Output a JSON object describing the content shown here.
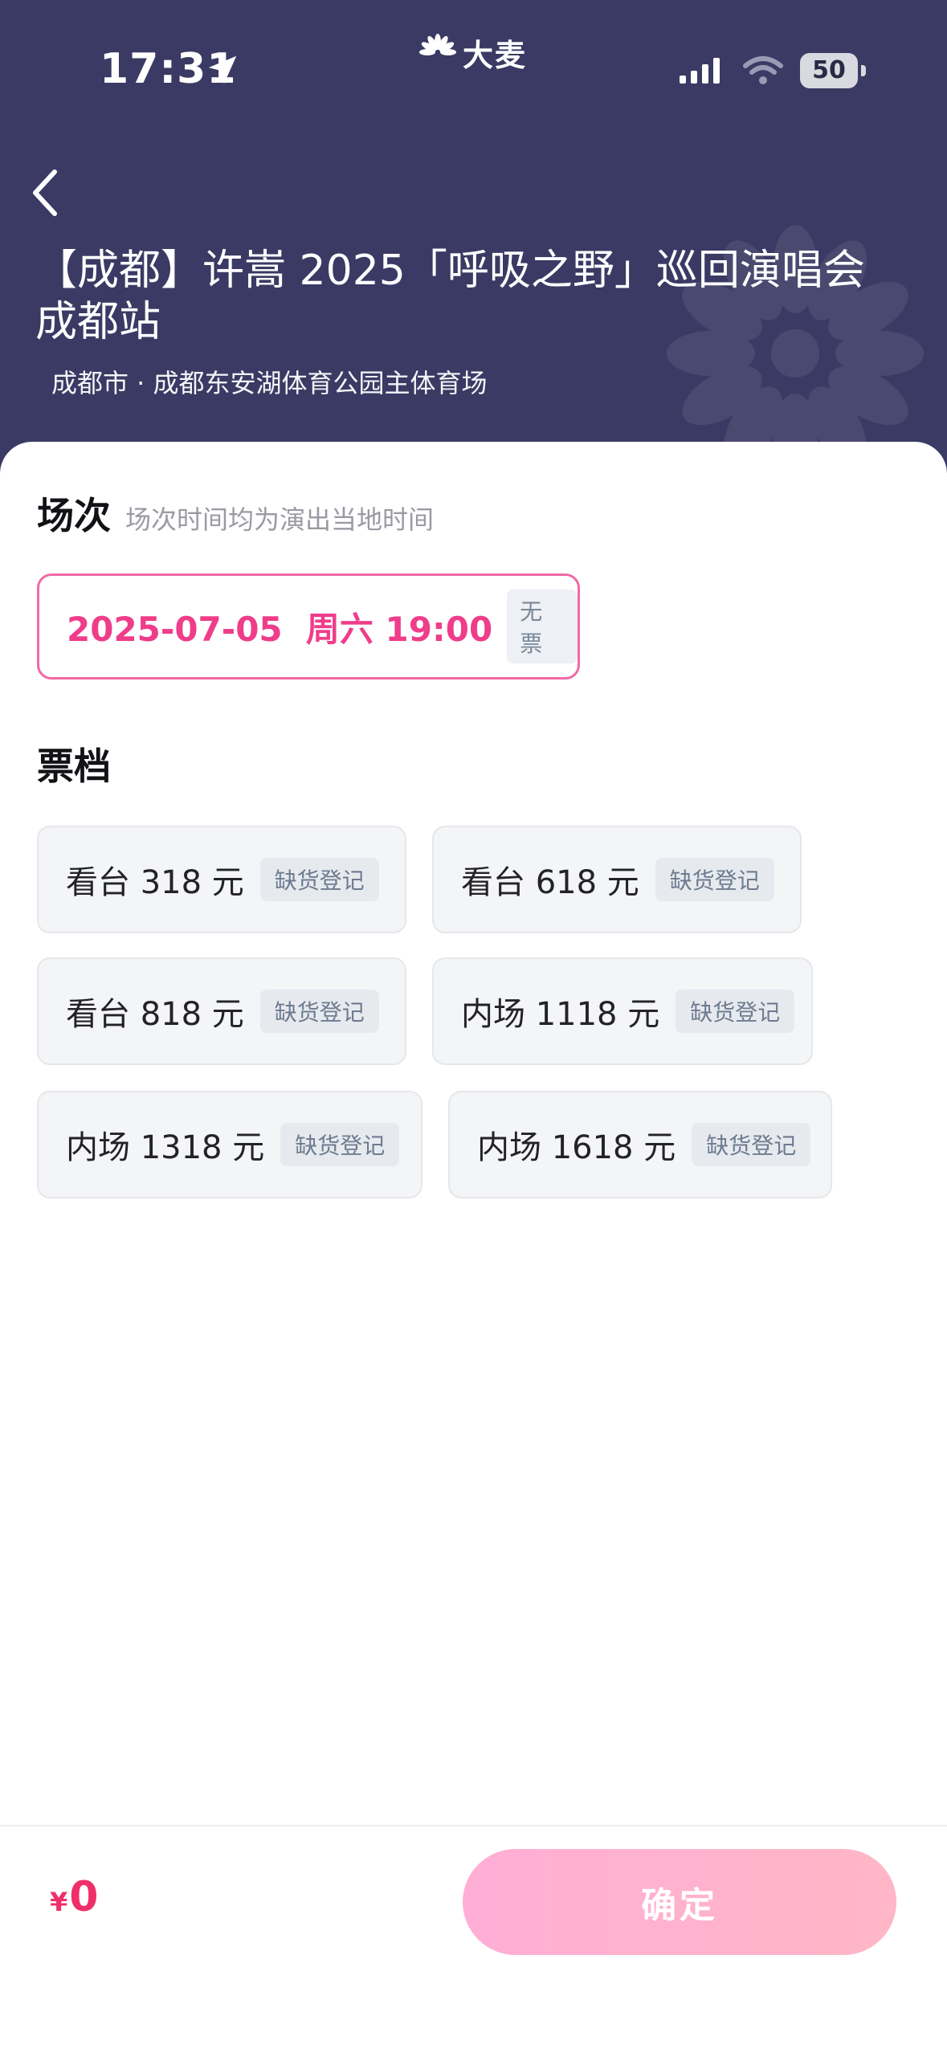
{
  "status_bar": {
    "time": "17:31",
    "battery": "50"
  },
  "brand": {
    "name": "大麦"
  },
  "header": {
    "title": "【成都】许嵩 2025「呼吸之野」巡回演唱会 成都站",
    "venue": "成都市 · 成都东安湖体育公园主体育场"
  },
  "session": {
    "title": "场次",
    "note": "场次时间均为演出当地时间",
    "selected": {
      "date": "2025-07-05  周六 19:00",
      "status": "无票"
    }
  },
  "tiers": {
    "title": "票档",
    "items": [
      {
        "label": "看台 318 元",
        "badge": "缺货登记"
      },
      {
        "label": "看台 618 元",
        "badge": "缺货登记"
      },
      {
        "label": "看台 818 元",
        "badge": "缺货登记"
      },
      {
        "label": "内场 1118 元",
        "badge": "缺货登记"
      },
      {
        "label": "内场 1318 元",
        "badge": "缺货登记"
      },
      {
        "label": "内场 1618 元",
        "badge": "缺货登记"
      }
    ]
  },
  "footer": {
    "currency": "¥",
    "total": "0",
    "confirm_label": "确定"
  },
  "colors": {
    "header_bg": "#3a3a64",
    "accent_pink": "#ef3d8a",
    "confirm_gradient_start": "#ffaed6",
    "confirm_gradient_end": "#ffb6c6"
  }
}
